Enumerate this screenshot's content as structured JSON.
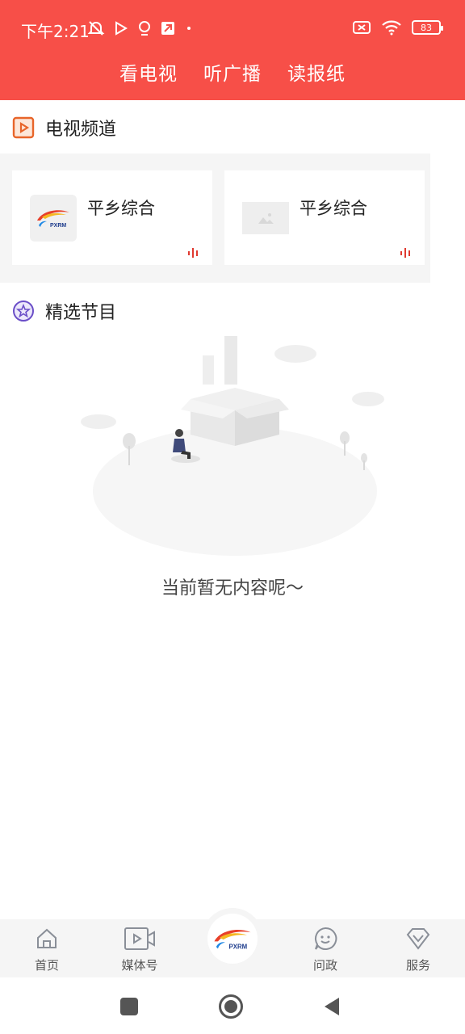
{
  "status_bar": {
    "time": "下午2:21",
    "battery": "83"
  },
  "top_tabs": [
    {
      "label": "看电视",
      "active": true
    },
    {
      "label": "听广播",
      "active": false
    },
    {
      "label": "读报纸",
      "active": false
    }
  ],
  "tv_section": {
    "title": "电视频道",
    "icon": "play-square-icon",
    "channels": [
      {
        "name": "平乡综合",
        "thumb": "pxrm-logo"
      },
      {
        "name": "平乡综合",
        "thumb": "image-placeholder-icon"
      }
    ]
  },
  "featured_section": {
    "title": "精选节目",
    "icon": "star-badge-icon",
    "empty_message": "当前暂无内容呢～"
  },
  "logo_text": "PXRM",
  "bottom_nav": [
    {
      "label": "首页",
      "icon": "home-icon"
    },
    {
      "label": "媒体号",
      "icon": "video-icon"
    },
    {
      "label": "",
      "icon": "pxrm-logo"
    },
    {
      "label": "问政",
      "icon": "chat-bubble-icon"
    },
    {
      "label": "服务",
      "icon": "diamond-icon"
    }
  ],
  "colors": {
    "brand_red": "#f74f48",
    "accent_orange": "#e8652a",
    "accent_purple": "#6b4fc8",
    "background_gray": "#f5f5f5"
  }
}
